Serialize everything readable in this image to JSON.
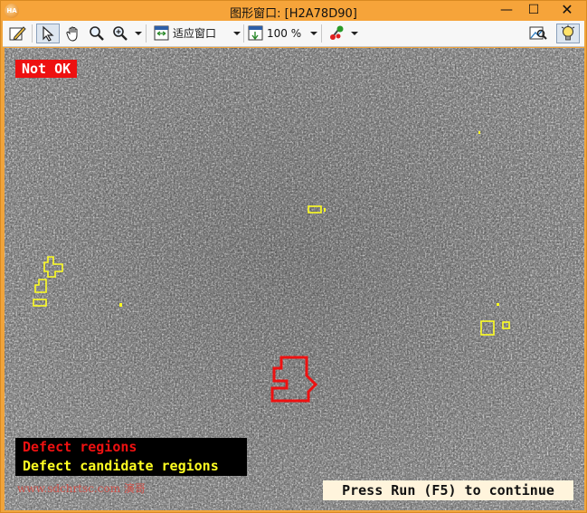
{
  "window": {
    "title": "图形窗口: [H2A78D90]",
    "app_icon_text": "HA",
    "minimize": "—",
    "maximize": "☐",
    "close": "✕"
  },
  "toolbar": {
    "fit_mode": "适应窗口",
    "zoom": "100 %"
  },
  "canvas": {
    "status_badge": "Not OK",
    "legend_defect": "Defect regions",
    "legend_candidate": "Defect candidate regions",
    "watermark": "www.sdchrtsc.com 演哥",
    "continue_prompt": "Press Run (F5) to continue"
  },
  "colors": {
    "defect": "#ee1111",
    "candidate": "#ffff22",
    "titlebar": "#f6a43a"
  },
  "icons": [
    "edit-icon",
    "pointer-icon",
    "hand-icon",
    "magnify-icon",
    "zoom-in-icon",
    "fit-window-icon",
    "zoom-percent-icon",
    "color-picker-icon",
    "inspect-icon",
    "bulb-icon"
  ]
}
